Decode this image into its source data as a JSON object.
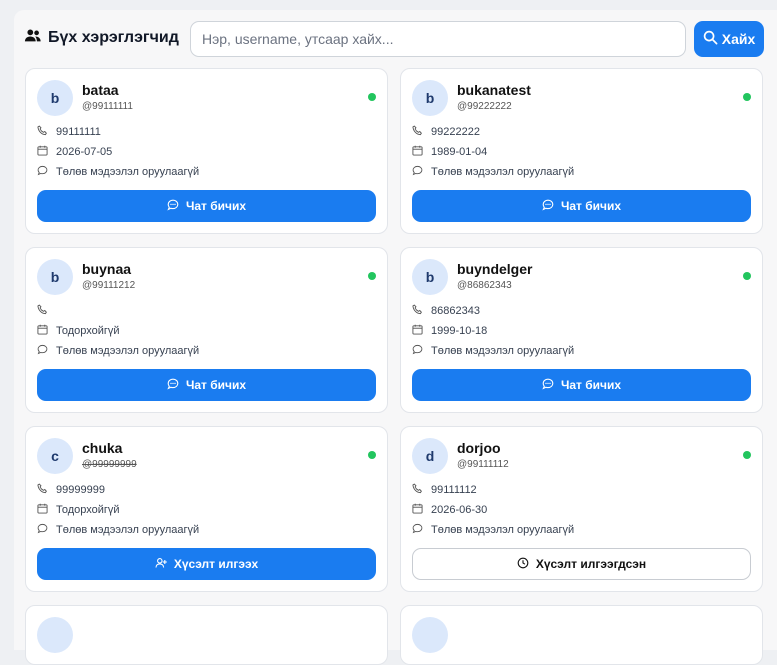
{
  "header": {
    "title": "Бүх хэрэглэгчид",
    "title_icon": "users-icon",
    "search_placeholder": "Нэр, username, утсаар хайх...",
    "search_button": "Хайх"
  },
  "colors": {
    "accent": "#1a7cf0",
    "online": "#22c55e",
    "avatar_bg": "#dbe8fb"
  },
  "users": [
    {
      "initial": "b",
      "username": "bataa",
      "handle": "@99111111",
      "phone": "99111111",
      "date": "2026-07-05",
      "bio": "Төлөв мэдээлэл оруулаагүй",
      "action": "Чат бичих",
      "action_icon": "chat-icon"
    },
    {
      "initial": "b",
      "username": "bukanatest",
      "handle": "@99222222",
      "phone": "99222222",
      "date": "1989-01-04",
      "bio": "Төлөв мэдээлэл оруулаагүй",
      "action": "Чат бичих",
      "action_icon": "chat-icon"
    },
    {
      "initial": "b",
      "username": "buynaa",
      "handle": "@99111212",
      "phone": "",
      "date": "Тодорхойгүй",
      "bio": "Төлөв мэдээлэл оруулаагүй",
      "action": "Чат бичих",
      "action_icon": "chat-icon"
    },
    {
      "initial": "b",
      "username": "buyndelger",
      "handle": "@86862343",
      "phone": "86862343",
      "date": "1999-10-18",
      "bio": "Төлөв мэдээлэл оруулаагүй",
      "action": "Чат бичих",
      "action_icon": "chat-icon"
    },
    {
      "initial": "c",
      "username": "chuka",
      "handle": "@99999999",
      "phone": "99999999",
      "date": "Тодорхойгүй",
      "bio": "Төлөв мэдээлэл оруулаагүй",
      "action": "Хүсэлт илгээх",
      "action_icon": "user-plus-icon"
    },
    {
      "initial": "d",
      "username": "dorjoo",
      "handle": "@99111112",
      "phone": "99111112",
      "date": "2026-06-30",
      "bio": "Төлөв мэдээлэл оруулаагүй",
      "action": "Хүсэлт илгээгдсэн",
      "action_icon": "clock-icon"
    }
  ]
}
